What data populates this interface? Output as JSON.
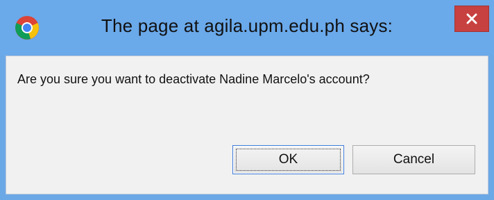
{
  "dialog": {
    "title": "The page at agila.upm.edu.ph says:",
    "message": "Are you sure you want to deactivate Nadine Marcelo's account?",
    "close_icon": "close-icon",
    "app_icon": "chrome-icon"
  },
  "buttons": {
    "ok_label": "OK",
    "cancel_label": "Cancel"
  },
  "colors": {
    "title_bar": "#6aa9ea",
    "close_button": "#c74140",
    "content_bg": "#f1f1f1"
  }
}
